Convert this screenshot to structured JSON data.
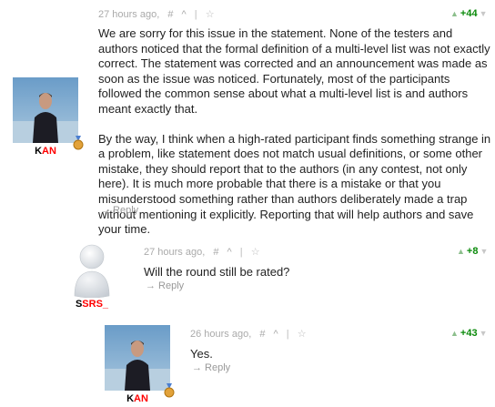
{
  "comments": [
    {
      "author_prefix": "K",
      "author_rest": "AN",
      "timestamp": "27 hours ago,",
      "hash": "#",
      "caret": "^",
      "sep": "|",
      "score": "+44",
      "paragraphs": [
        "We are sorry for this issue in the statement. None of the testers and authors noticed that the formal definition of a multi-level list was not exactly correct. The statement was corrected and an announcement was made as soon as the issue was noticed. Fortunately, most of the participants followed the common sense about what a multi-level list is and authors meant exactly that.",
        "By the way, I think when a high-rated participant finds something strange in a problem, like statement does not match usual definitions, or some other mistake, they should report that to the authors (in any contest, not only here). It is much more probable that there is a mistake or that you misunderstood something rather than authors deliberately made a trap without mentioning it explicitly. Reporting that will help authors and save your time."
      ],
      "reply": "→ Reply"
    },
    {
      "author_prefix": "S",
      "author_rest": "SRS_",
      "timestamp": "27 hours ago,",
      "hash": "#",
      "caret": "^",
      "sep": "|",
      "score": "+8",
      "paragraphs": [
        "Will the round still be rated?"
      ],
      "reply": "→ Reply"
    },
    {
      "author_prefix": "K",
      "author_rest": "AN",
      "timestamp": "26 hours ago,",
      "hash": "#",
      "caret": "^",
      "sep": "|",
      "score": "+43",
      "paragraphs": [
        "Yes."
      ],
      "reply": "→ Reply"
    }
  ],
  "icons": {
    "star": "star-icon",
    "vote_up": "triangle-up-icon",
    "vote_down": "triangle-down-icon",
    "medal": "medal-icon"
  },
  "colors": {
    "username_red": "#ff0000",
    "score_green": "#0a8a0a",
    "meta_gray": "#aaaaaa"
  }
}
